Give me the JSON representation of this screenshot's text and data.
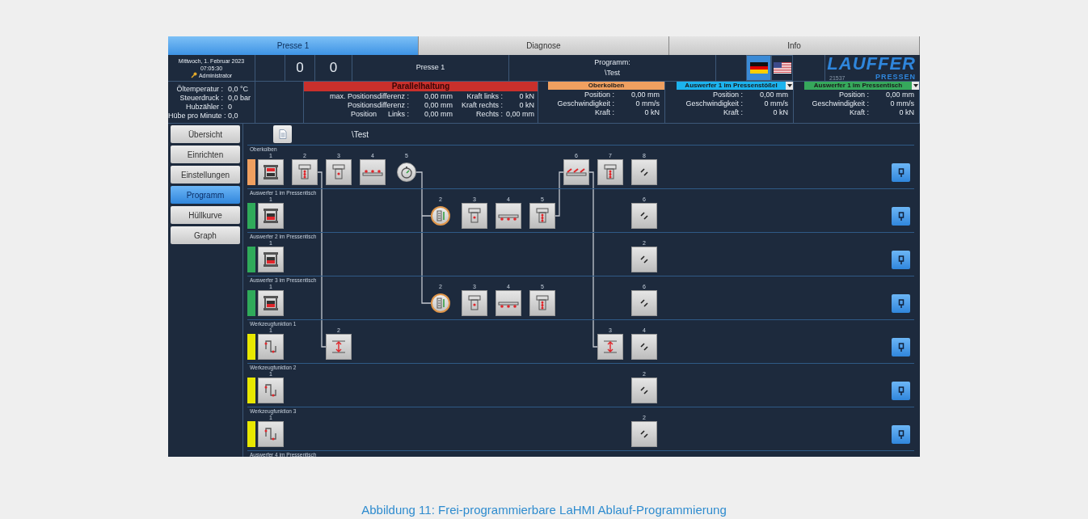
{
  "tabs": [
    {
      "label": "Presse 1",
      "selected": true
    },
    {
      "label": "Diagnose",
      "selected": false
    },
    {
      "label": "Info",
      "selected": false
    }
  ],
  "header": {
    "date": "Mittwoch, 1. Februar 2023",
    "time": "07:05:30",
    "user": "Administrator",
    "counters": [
      "0",
      "0"
    ],
    "press": "Presse 1",
    "program_label": "Programm:",
    "program_value": "\\Test",
    "languages": [
      {
        "kind": "de",
        "selected": true
      },
      {
        "kind": "us",
        "selected": false
      }
    ],
    "logo": {
      "name": "LAUFFER",
      "number": "21537",
      "sub": "PRESSEN"
    }
  },
  "readings": [
    {
      "label": "Öltemperatur :",
      "value": "0,0 °C"
    },
    {
      "label": "Steuerdruck :",
      "value": "0,0 bar"
    },
    {
      "label": "Hubzähler :",
      "value": "0"
    },
    {
      "label": "Hübe pro Minute :",
      "value": "0,0"
    }
  ],
  "parallel": {
    "title": "Parallelhaltung",
    "color": "#c9302c",
    "rows": [
      {
        "label": "max. Positionsdifferenz :",
        "value": "0,00 mm",
        "label2": "Kraft links :",
        "value2": "0 kN"
      },
      {
        "label": "Positionsdifferenz :",
        "value": "0,00 mm",
        "label2": "Kraft rechts :",
        "value2": "0 kN"
      },
      {
        "label": "Position",
        "sublabel": "Links :",
        "value": "0,00 mm",
        "label2": "Rechts :",
        "value2": "0,00 mm"
      }
    ]
  },
  "axes": [
    {
      "title": "Oberkolben",
      "color": "#f0a060",
      "dropdown": false,
      "rows": [
        {
          "label": "Position :",
          "value": "0,00 mm"
        },
        {
          "label": "Geschwindigkeit :",
          "value": "0 mm/s"
        },
        {
          "label": "Kraft :",
          "value": "0 kN"
        }
      ]
    },
    {
      "title": "Auswerfer 1 im Pressenstößel",
      "color": "#1cb3ee",
      "dropdown": true,
      "rows": [
        {
          "label": "Position :",
          "value": "0,00 mm"
        },
        {
          "label": "Geschwindigkeit :",
          "value": "0 mm/s"
        },
        {
          "label": "Kraft :",
          "value": "0 kN"
        }
      ]
    },
    {
      "title": "Auswerfer 1 im Pressentisch",
      "color": "#36a85c",
      "dropdown": true,
      "rows": [
        {
          "label": "Position :",
          "value": "0,00 mm"
        },
        {
          "label": "Geschwindigkeit :",
          "value": "0 mm/s"
        },
        {
          "label": "Kraft :",
          "value": "0 kN"
        }
      ]
    }
  ],
  "sidebar": [
    {
      "label": "Übersicht",
      "selected": false
    },
    {
      "label": "Einrichten",
      "selected": false
    },
    {
      "label": "Einstellungen",
      "selected": false
    },
    {
      "label": "Programm",
      "selected": true
    },
    {
      "label": "Hüllkurve",
      "selected": false
    },
    {
      "label": "Graph",
      "selected": false
    }
  ],
  "program": {
    "file": "\\Test",
    "lanes": [
      {
        "label": "Oberkolben",
        "color": "#f0a060",
        "steps": [
          {
            "kind": "press",
            "number": "1"
          },
          {
            "kind": "ram_multi",
            "number": "2",
            "link_down": true
          },
          {
            "kind": "ram_single",
            "number": "3"
          },
          {
            "kind": "plate_stars",
            "number": "4"
          },
          {
            "kind": "timer",
            "number": "5",
            "link_down": true
          },
          {
            "kind": "none"
          },
          {
            "kind": "none"
          },
          {
            "kind": "none"
          },
          {
            "kind": "none"
          },
          {
            "kind": "plate_slanted",
            "number": "6",
            "link_down": true
          },
          {
            "kind": "ram_multi",
            "number": "7"
          },
          {
            "kind": "end",
            "number": "8"
          }
        ]
      },
      {
        "label": "Auswerfer 1 im Pressentisch",
        "color": "#2faa5a",
        "steps": [
          {
            "kind": "ejector_press",
            "number": "1"
          },
          {
            "kind": "none"
          },
          {
            "kind": "none"
          },
          {
            "kind": "none"
          },
          {
            "kind": "none"
          },
          {
            "kind": "gauge",
            "number": "2"
          },
          {
            "kind": "ejector_single",
            "number": "3"
          },
          {
            "kind": "ejector_plate",
            "number": "4"
          },
          {
            "kind": "ejector_multi",
            "number": "5",
            "link_up": true
          },
          {
            "kind": "none"
          },
          {
            "kind": "none"
          },
          {
            "kind": "end",
            "number": "6"
          }
        ]
      },
      {
        "label": "Auswerfer 2 im Pressentisch",
        "color": "#2faa5a",
        "steps": [
          {
            "kind": "ejector_press",
            "number": "1"
          },
          {
            "kind": "none"
          },
          {
            "kind": "none"
          },
          {
            "kind": "none"
          },
          {
            "kind": "none"
          },
          {
            "kind": "none"
          },
          {
            "kind": "none"
          },
          {
            "kind": "none"
          },
          {
            "kind": "none"
          },
          {
            "kind": "none"
          },
          {
            "kind": "none"
          },
          {
            "kind": "end",
            "number": "2"
          }
        ]
      },
      {
        "label": "Auswerfer 3 im Pressentisch",
        "color": "#2faa5a",
        "steps": [
          {
            "kind": "ejector_press",
            "number": "1"
          },
          {
            "kind": "none"
          },
          {
            "kind": "none"
          },
          {
            "kind": "none"
          },
          {
            "kind": "none"
          },
          {
            "kind": "gauge",
            "number": "2"
          },
          {
            "kind": "ejector_single",
            "number": "3"
          },
          {
            "kind": "ejector_plate",
            "number": "4"
          },
          {
            "kind": "ejector_multi",
            "number": "5"
          },
          {
            "kind": "none"
          },
          {
            "kind": "none"
          },
          {
            "kind": "end",
            "number": "6"
          }
        ]
      },
      {
        "label": "Werkzeugfunktion 1",
        "color": "#e8e800",
        "steps": [
          {
            "kind": "tool_step",
            "number": "1"
          },
          {
            "kind": "none"
          },
          {
            "kind": "stroke",
            "number": "2"
          },
          {
            "kind": "none"
          },
          {
            "kind": "none"
          },
          {
            "kind": "none"
          },
          {
            "kind": "none"
          },
          {
            "kind": "none"
          },
          {
            "kind": "none"
          },
          {
            "kind": "none"
          },
          {
            "kind": "stroke",
            "number": "3"
          },
          {
            "kind": "end",
            "number": "4"
          }
        ]
      },
      {
        "label": "Werkzeugfunktion 2",
        "color": "#e8e800",
        "steps": [
          {
            "kind": "tool_step",
            "number": "1"
          },
          {
            "kind": "none"
          },
          {
            "kind": "none"
          },
          {
            "kind": "none"
          },
          {
            "kind": "none"
          },
          {
            "kind": "none"
          },
          {
            "kind": "none"
          },
          {
            "kind": "none"
          },
          {
            "kind": "none"
          },
          {
            "kind": "none"
          },
          {
            "kind": "none"
          },
          {
            "kind": "end",
            "number": "2"
          }
        ]
      },
      {
        "label": "Werkzeugfunktion 3",
        "color": "#e8e800",
        "steps": [
          {
            "kind": "tool_step",
            "number": "1"
          },
          {
            "kind": "none"
          },
          {
            "kind": "none"
          },
          {
            "kind": "none"
          },
          {
            "kind": "none"
          },
          {
            "kind": "none"
          },
          {
            "kind": "none"
          },
          {
            "kind": "none"
          },
          {
            "kind": "none"
          },
          {
            "kind": "none"
          },
          {
            "kind": "none"
          },
          {
            "kind": "end",
            "number": "2"
          }
        ]
      },
      {
        "label": "Auswerfer 4 im Pressentisch"
      }
    ]
  },
  "caption": "Abbildung 11: Frei-programmierbare LaHMI Ablauf-Programmierung"
}
